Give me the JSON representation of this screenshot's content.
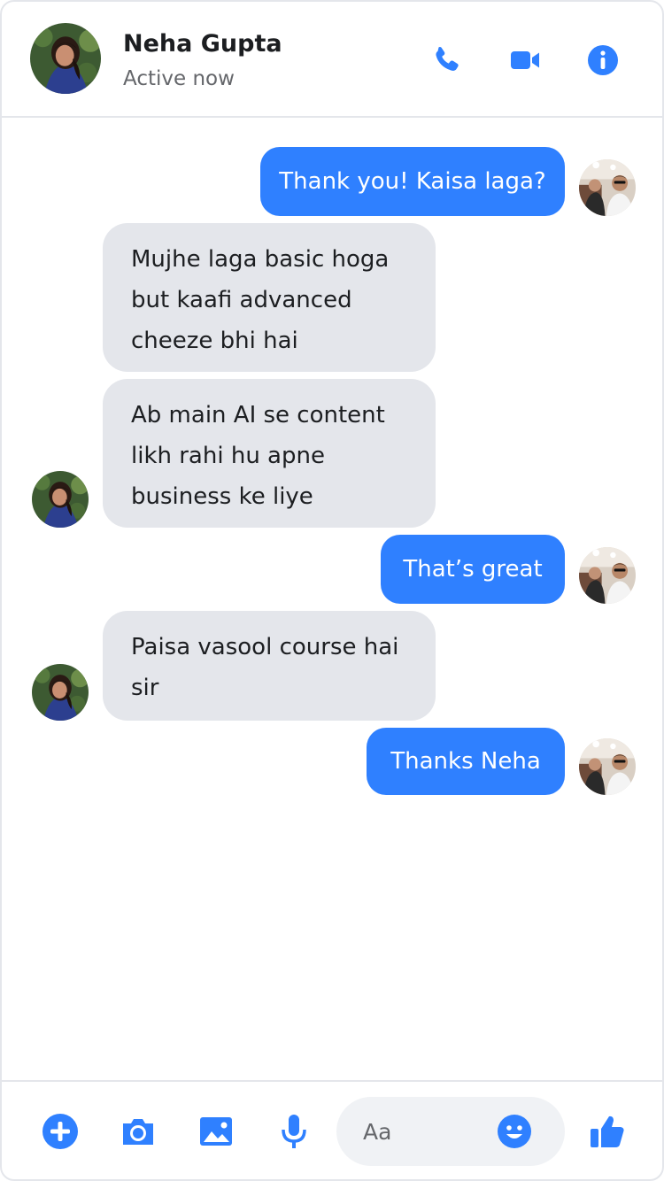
{
  "header": {
    "contact_name": "Neha Gupta",
    "status": "Active now",
    "icons": [
      "phone-icon",
      "video-camera-icon",
      "info-icon"
    ]
  },
  "messages": [
    {
      "direction": "outgoing",
      "text": "Thank you! Kaisa laga?"
    },
    {
      "direction": "incoming",
      "text": "Mujhe laga basic hoga but kaafi advanced cheeze bhi hai"
    },
    {
      "direction": "incoming",
      "text": "Ab main AI se content likh rahi hu apne business ke liye"
    },
    {
      "direction": "outgoing",
      "text": "That’s great"
    },
    {
      "direction": "incoming",
      "text": "Paisa vasool course hai sir"
    },
    {
      "direction": "outgoing",
      "text": "Thanks Neha"
    }
  ],
  "composer": {
    "placeholder": "Aa",
    "icons": [
      "add-icon",
      "camera-icon",
      "image-icon",
      "microphone-icon",
      "emoji-icon",
      "thumbs-up-icon"
    ]
  },
  "colors": {
    "accent": "#2f80ff",
    "incoming_bubble": "#e4e6eb",
    "text_primary": "#1c1e21",
    "text_secondary": "#65676b",
    "divider": "#e4e6eb",
    "composer_bg": "#f0f2f5"
  }
}
